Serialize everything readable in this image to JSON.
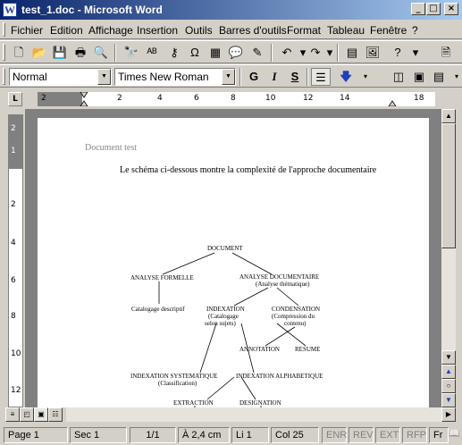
{
  "window": {
    "title": "test_1.doc - Microsoft Word"
  },
  "menu": [
    "Fichier",
    "Edition",
    "Affichage",
    "Insertion",
    "Outils",
    "Barres d'outils",
    "Format",
    "Tableau",
    "Fenêtre",
    "?"
  ],
  "formatting": {
    "style": "Normal",
    "font": "Times New Roman",
    "bold": "G",
    "italic": "I",
    "underline": "S"
  },
  "ruler": {
    "numbers": [
      "2",
      "2",
      "4",
      "6",
      "8",
      "10",
      "12",
      "14",
      "18"
    ],
    "vnumbers": [
      "2",
      "1",
      "2",
      "4",
      "6",
      "8",
      "10",
      "12"
    ]
  },
  "document": {
    "header": "Document test",
    "intro": "Le schéma ci-dessous montre la complexité de l'approche documentaire",
    "diagram": {
      "root": "DOCUMENT",
      "analyse_formelle": "ANALYSE FORMELLE",
      "analyse_doc": "ANALYSE DOCUMENTAIRE",
      "analyse_doc_sub": "(Analyse thématique)",
      "catalogage": "Catalogage descriptif",
      "indexation": "INDEXATION",
      "indexation_sub1": "(Catalogage",
      "indexation_sub2": "selon sujets)",
      "condensation": "CONDENSATION",
      "condensation_sub1": "(Compression du",
      "condensation_sub2": "contenu)",
      "annotation": "ANNOTATION",
      "resume": "RESUME",
      "index_sys": "INDEXATION SYSTEMATIQUE",
      "index_sys_sub": "(Classification)",
      "index_alpha": "INDEXATION ALPHABETIQUE",
      "extraction": "EXTRACTION",
      "designation": "DESIGNATION"
    }
  },
  "status": {
    "page": "Page 1",
    "section": "Sec 1",
    "pages": "1/1",
    "position": "À 2,4 cm",
    "line": "Li 1",
    "col": "Col 25",
    "enr": "ENR",
    "rev": "REV",
    "ext": "EXT",
    "rfp": "RFP",
    "lang": "Fr"
  }
}
